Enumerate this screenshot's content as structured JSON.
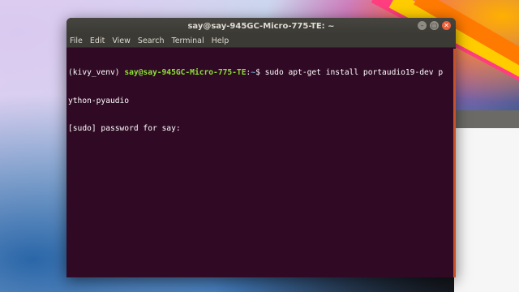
{
  "window": {
    "title": "say@say-945GC-Micro-775-TE: ~",
    "controls": [
      "minimize",
      "maximize",
      "close"
    ]
  },
  "menu": [
    "File",
    "Edit",
    "View",
    "Search",
    "Terminal",
    "Help"
  ],
  "terminal": {
    "venv": "(kivy_venv) ",
    "user_host": "say@say-945GC-Micro-775-TE",
    "colon": ":",
    "path": "~",
    "prompt_symbol": "$ ",
    "command_part1": "sudo apt-get install portaudio19-dev p",
    "command_part2": "ython-pyaudio",
    "sudo_prompt": "[sudo] password for say: "
  },
  "colors": {
    "terminal_bg": "#300a24",
    "prompt_user": "#8ae234",
    "prompt_path": "#729fcf",
    "close_button": "#e9603a"
  }
}
